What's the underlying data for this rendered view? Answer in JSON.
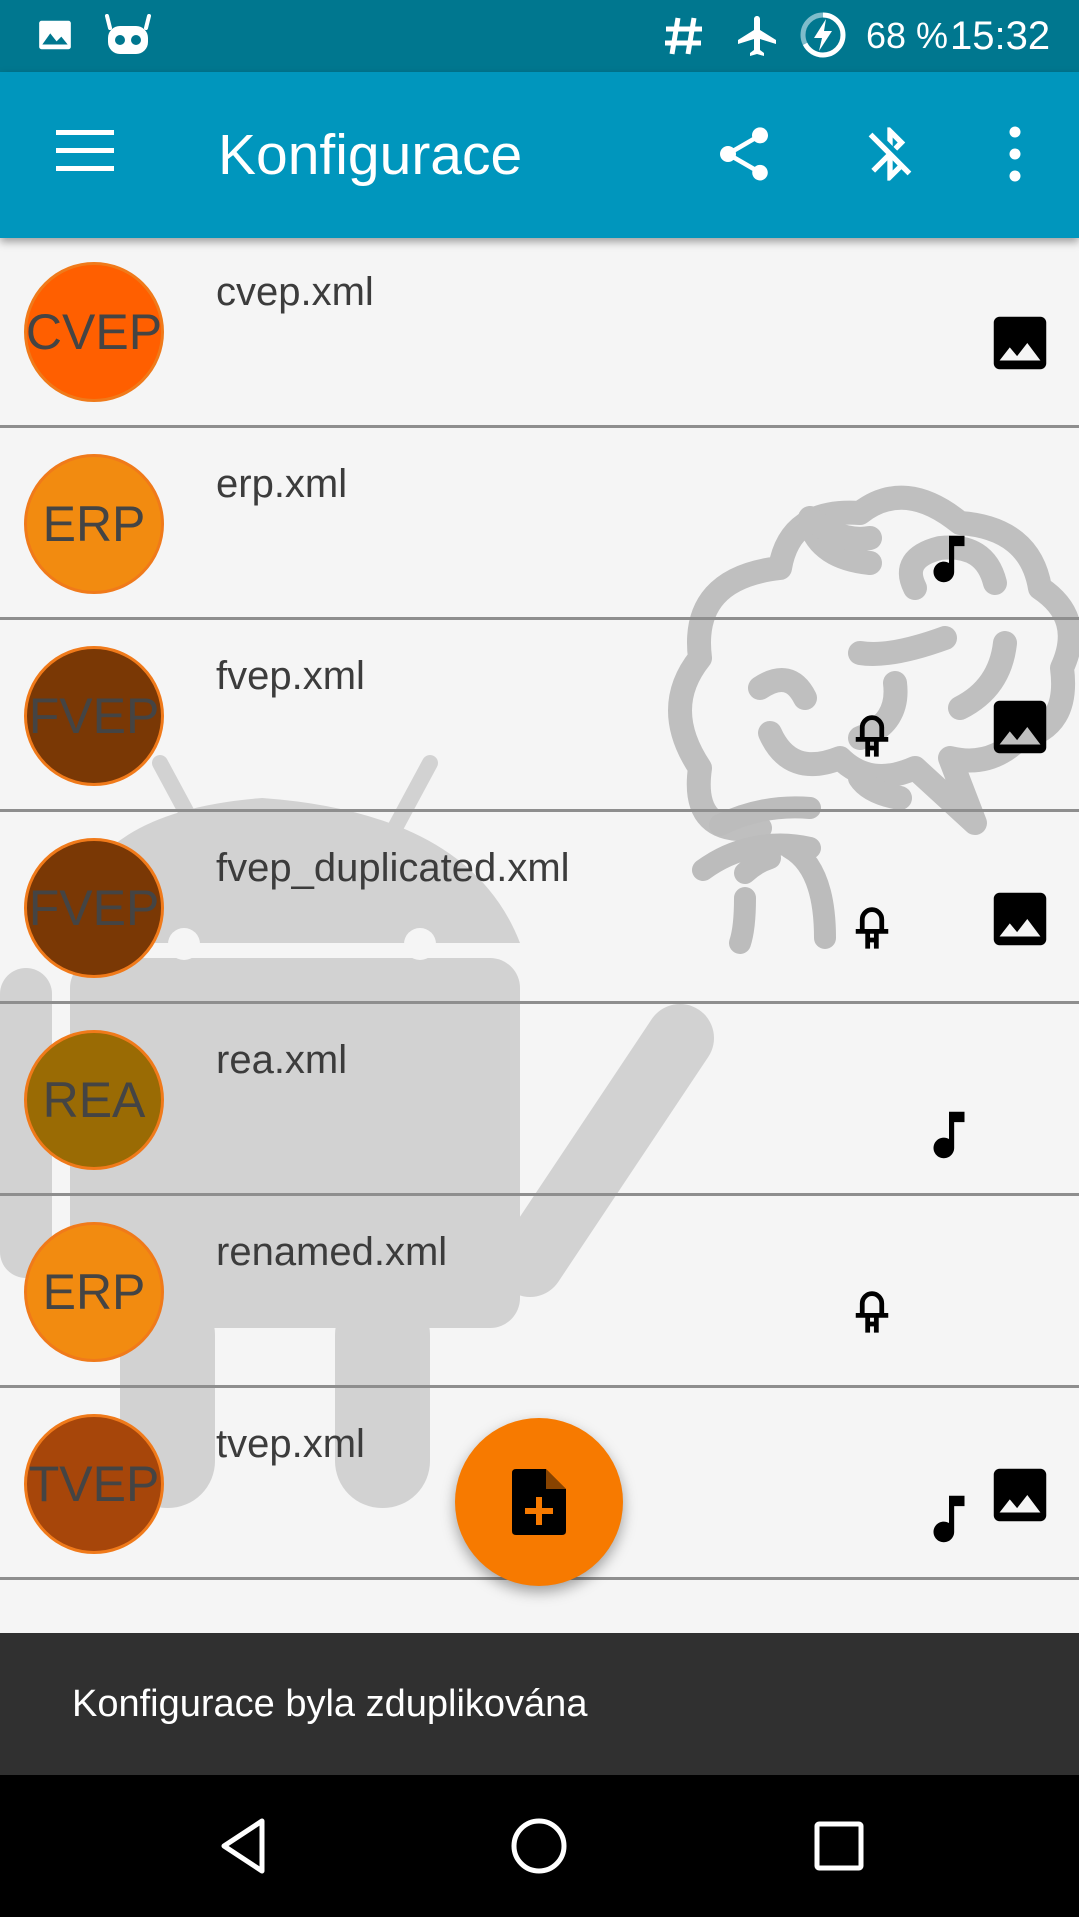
{
  "status_bar": {
    "battery": "68 %",
    "time": "15:32",
    "icons": [
      "image-notification-icon",
      "cyanogen-notification-icon",
      "hash-icon",
      "airplane-mode-icon",
      "battery-charging-icon"
    ]
  },
  "app_bar": {
    "title": "Konfigurace",
    "icons": [
      "menu-icon",
      "share-icon",
      "bluetooth-disabled-icon",
      "overflow-menu-icon"
    ]
  },
  "configurations": [
    {
      "badge": "CVEP",
      "badge_color": "#ff5f00",
      "filename": "cvep.xml",
      "has_led": false,
      "has_audio": false,
      "has_image": true
    },
    {
      "badge": "ERP",
      "badge_color": "#f28b10",
      "filename": "erp.xml",
      "has_led": false,
      "has_audio": true,
      "has_image": false
    },
    {
      "badge": "FVEP",
      "badge_color": "#7a3805",
      "filename": "fvep.xml",
      "has_led": true,
      "has_audio": false,
      "has_image": true
    },
    {
      "badge": "FVEP",
      "badge_color": "#7a3805",
      "filename": "fvep_duplicated.xml",
      "has_led": true,
      "has_audio": false,
      "has_image": true
    },
    {
      "badge": "REA",
      "badge_color": "#9a6b04",
      "filename": "rea.xml",
      "has_led": false,
      "has_audio": true,
      "has_image": false
    },
    {
      "badge": "ERP",
      "badge_color": "#f28b10",
      "filename": "renamed.xml",
      "has_led": true,
      "has_audio": false,
      "has_image": false
    },
    {
      "badge": "TVEP",
      "badge_color": "#a7460a",
      "filename": "tvep.xml",
      "has_led": false,
      "has_audio": true,
      "has_image": true
    }
  ],
  "fab": {
    "icon": "add-file-icon",
    "color": "#f77a00"
  },
  "snackbar": {
    "message": "Konfigurace byla zduplikována"
  },
  "nav_bar": {
    "icons": [
      "back-icon",
      "home-icon",
      "recents-icon"
    ]
  }
}
